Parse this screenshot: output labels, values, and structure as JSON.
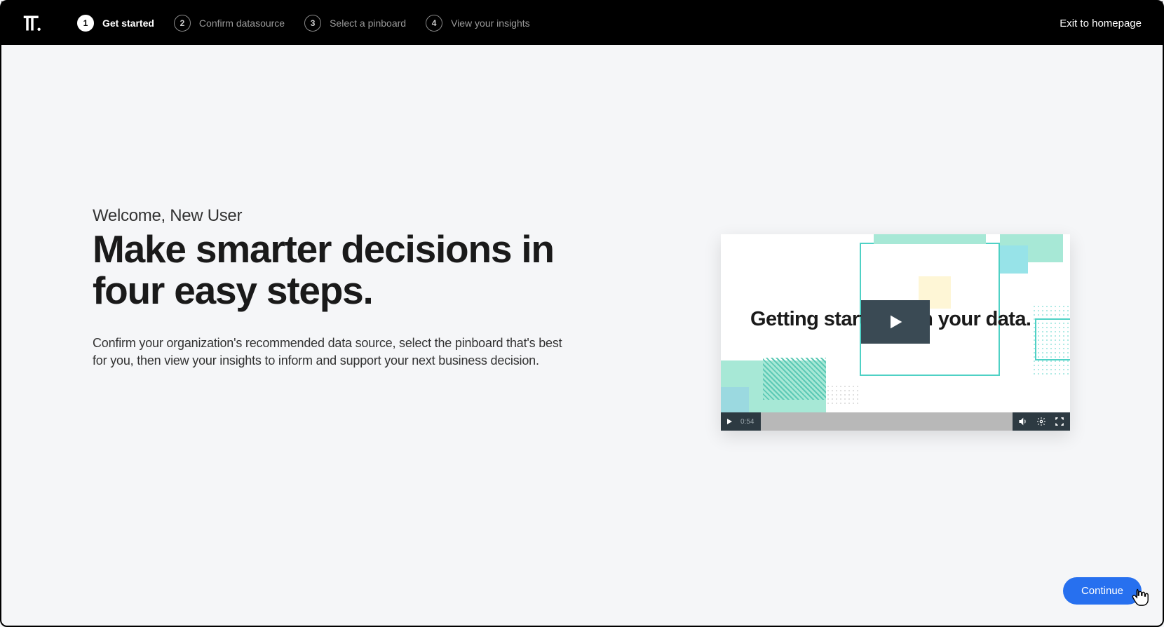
{
  "header": {
    "steps": [
      {
        "num": "1",
        "label": "Get started"
      },
      {
        "num": "2",
        "label": "Confirm datasource"
      },
      {
        "num": "3",
        "label": "Select a pinboard"
      },
      {
        "num": "4",
        "label": "View your insights"
      }
    ],
    "exit_label": "Exit to homepage"
  },
  "main": {
    "welcome": "Welcome, New User",
    "headline": "Make smarter decisions in four easy steps.",
    "description": "Confirm your organization's recommended data source, select the pinboard that's best for you, then view your insights to inform and support your next business decision."
  },
  "video": {
    "title": "Getting started with your data.",
    "time": "0:54"
  },
  "footer": {
    "continue_label": "Continue"
  }
}
